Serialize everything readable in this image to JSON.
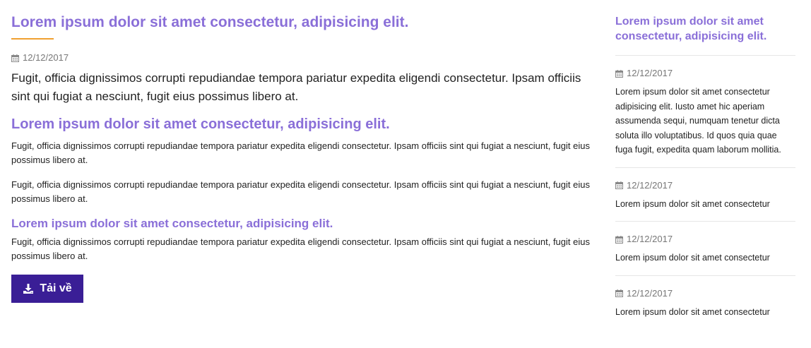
{
  "main": {
    "title": "Lorem ipsum dolor sit amet consectetur, adipisicing elit.",
    "date": "12/12/2017",
    "lead": "Fugit, officia dignissimos corrupti repudiandae tempora pariatur expedita eligendi consectetur. Ipsam officiis sint qui fugiat a nesciunt, fugit eius possimus libero at.",
    "heading2": "Lorem ipsum dolor sit amet consectetur, adipisicing elit.",
    "paragraph1": "Fugit, officia dignissimos corrupti repudiandae tempora pariatur expedita eligendi consectetur. Ipsam officiis sint qui fugiat a nesciunt, fugit eius possimus libero at.",
    "paragraph2": "Fugit, officia dignissimos corrupti repudiandae tempora pariatur expedita eligendi consectetur. Ipsam officiis sint qui fugiat a nesciunt, fugit eius possimus libero at.",
    "heading3": "Lorem ipsum dolor sit amet consectetur, adipisicing elit.",
    "paragraph3": "Fugit, officia dignissimos corrupti repudiandae tempora pariatur expedita eligendi consectetur. Ipsam officiis sint qui fugiat a nesciunt, fugit eius possimus libero at.",
    "download_label": "Tải về"
  },
  "sidebar": {
    "title": "Lorem ipsum dolor sit amet consectetur, adipisicing elit.",
    "items": [
      {
        "date": "12/12/2017",
        "text": "Lorem ipsum dolor sit amet consectetur adipisicing elit. Iusto amet hic aperiam assumenda sequi, numquam tenetur dicta soluta illo voluptatibus. Id quos quia quae fuga fugit, expedita quam laborum mollitia."
      },
      {
        "date": "12/12/2017",
        "text": "Lorem ipsum dolor sit amet consectetur"
      },
      {
        "date": "12/12/2017",
        "text": "Lorem ipsum dolor sit amet consectetur"
      },
      {
        "date": "12/12/2017",
        "text": "Lorem ipsum dolor sit amet consectetur"
      }
    ]
  },
  "colors": {
    "accent": "#8a6fd8",
    "underline": "#f0a030",
    "button": "#3a1e96"
  },
  "icons": {
    "date": "calendar-icon",
    "download": "download-icon"
  }
}
